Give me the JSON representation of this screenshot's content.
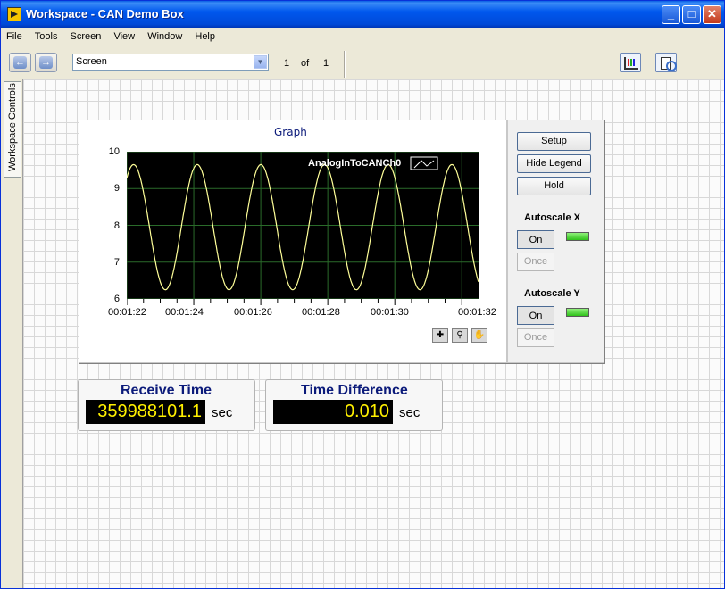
{
  "window": {
    "title": "Workspace - CAN Demo Box",
    "min": "_",
    "max": "□",
    "close": "✕"
  },
  "menu": [
    "File",
    "Tools",
    "Screen",
    "View",
    "Window",
    "Help"
  ],
  "toolbar": {
    "screen_select": "Screen",
    "page_current": "1",
    "page_of": "of",
    "page_total": "1",
    "icons": [
      "back-arrow-icon",
      "forward-arrow-icon",
      "chart-icon",
      "tools-icon"
    ]
  },
  "sidebar": {
    "tab_label": "Workspace Controls"
  },
  "graph": {
    "title": "Graph",
    "legend": "AnalogInToCANCh0",
    "y_ticks": [
      "10",
      "9",
      "8",
      "7",
      "6"
    ],
    "x_ticks": [
      "00:01:22",
      "00:01:24",
      "00:01:26",
      "00:01:28",
      "00:01:30",
      "00:01:32"
    ],
    "buttons": {
      "setup": "Setup",
      "hide_legend": "Hide Legend",
      "hold": "Hold"
    },
    "autoscale_x": {
      "label": "Autoscale X",
      "on": "On",
      "once": "Once"
    },
    "autoscale_y": {
      "label": "Autoscale Y",
      "on": "On",
      "once": "Once"
    },
    "palette_icons": [
      "crosshair-icon",
      "zoom-icon",
      "pan-hand-icon"
    ]
  },
  "chart_data": {
    "type": "line",
    "series": [
      {
        "name": "AnalogInToCANCh0",
        "color": "#ffff99"
      }
    ],
    "x_ticks": [
      "00:01:22",
      "00:01:24",
      "00:01:26",
      "00:01:28",
      "00:01:30",
      "00:01:32"
    ],
    "ylim": [
      6,
      10
    ],
    "y_ticks": [
      6,
      7,
      8,
      9,
      10
    ],
    "wave": {
      "center": 7.95,
      "amplitude": 1.7,
      "period_s": 1.9,
      "x_start_s": 82,
      "x_end_s": 92.5
    },
    "background": "#000000",
    "grid": true,
    "legend_placement": "top-right"
  },
  "indicators": {
    "receive_time": {
      "label": "Receive Time",
      "value": "359988101.1",
      "unit": "sec"
    },
    "time_difference": {
      "label": "Time Difference",
      "value": "0.010",
      "unit": "sec"
    }
  }
}
